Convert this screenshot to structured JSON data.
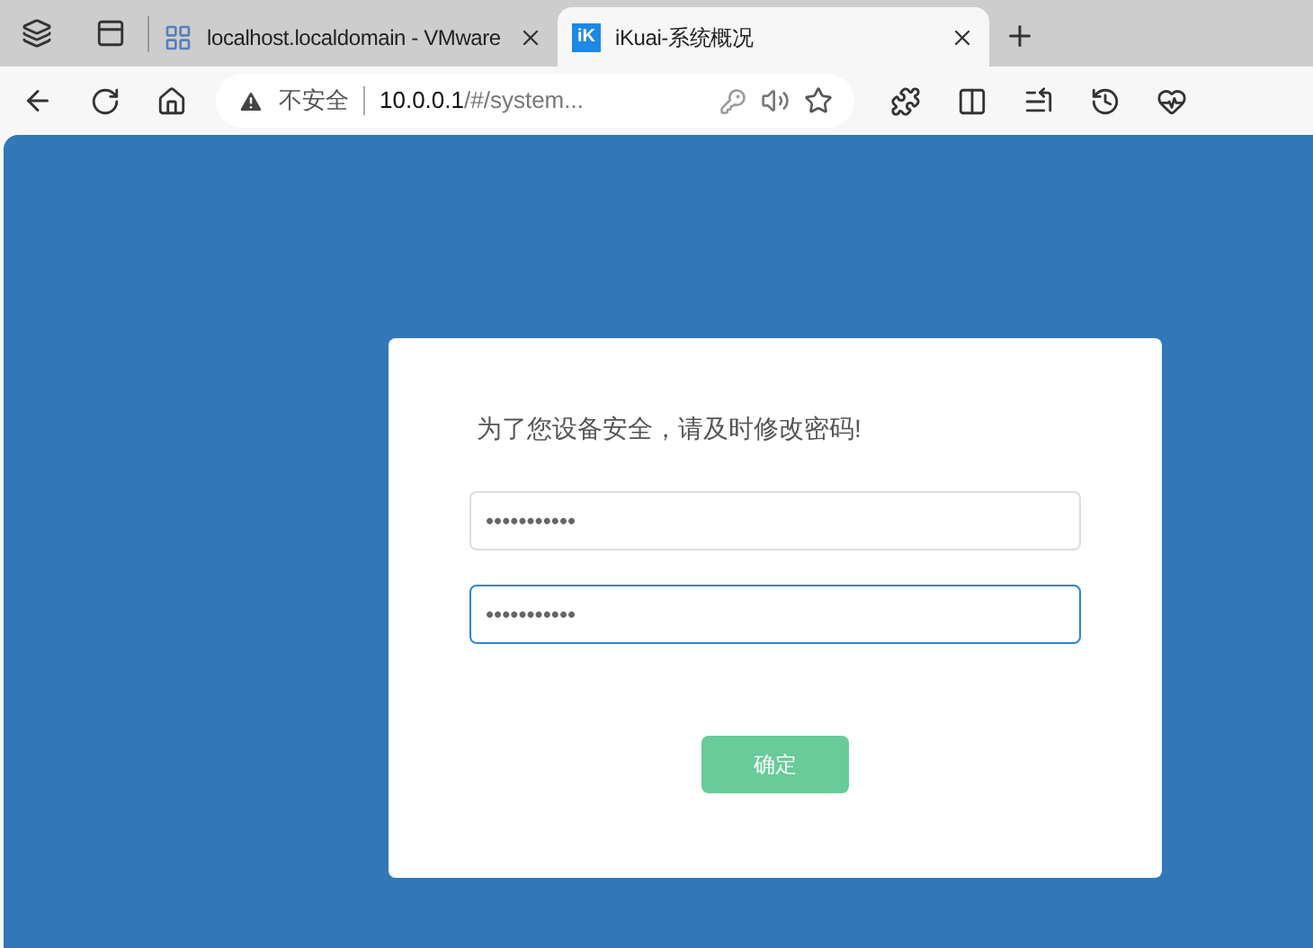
{
  "tabs": [
    {
      "title": "localhost.localdomain - VMware",
      "selected": false
    },
    {
      "title": "iKuai-系统概况",
      "favicon": "iK",
      "selected": true
    }
  ],
  "address_bar": {
    "security": "不安全",
    "url_host": "10.0.0.1",
    "url_path": "/#/system..."
  },
  "dialog": {
    "message": "为了您设备安全，请及时修改密码!",
    "fields": [
      {
        "value": "•••••••••••",
        "focused": false
      },
      {
        "value": "•••••••••••",
        "focused": true
      }
    ],
    "button": "确定"
  }
}
